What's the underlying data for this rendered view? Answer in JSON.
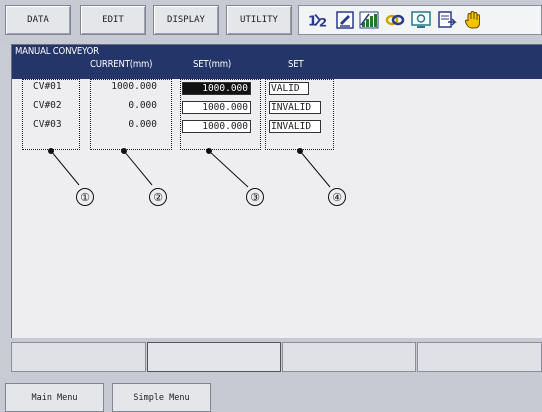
{
  "menu": {
    "data": "DATA",
    "edit": "EDIT",
    "display": "DISPLAY",
    "utility": "UTILITY"
  },
  "status_icons": [
    "numbered-steps-icon",
    "edit-document-icon",
    "signal-bars-icon",
    "link-icon",
    "monitor-icon",
    "page-arrow-icon",
    "hand-icon"
  ],
  "screen": {
    "title": "MANUAL CONVEYOR",
    "col_current": "CURRENT(mm)",
    "col_set_mm": "SET(mm)",
    "col_set": "SET",
    "rows": [
      {
        "name": "CV#01",
        "current": "1000.000",
        "set": "1000.000",
        "status": "VALID"
      },
      {
        "name": "CV#02",
        "current": "0.000",
        "set": "1000.000",
        "status": "INVALID"
      },
      {
        "name": "CV#03",
        "current": "0.000",
        "set": "1000.000",
        "status": "INVALID"
      }
    ]
  },
  "callouts": [
    "①",
    "②",
    "③",
    "④"
  ],
  "footer": {
    "main_menu": "Main Menu",
    "simple_menu": "Simple Menu"
  },
  "colors": {
    "title_bar": "#233569",
    "chrome": "#c7cad2",
    "screen_bg": "#eeeef0"
  }
}
